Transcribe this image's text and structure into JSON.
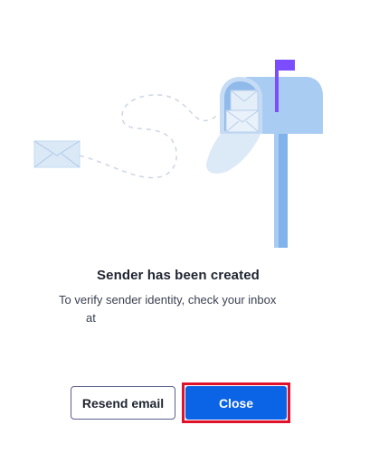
{
  "dialog": {
    "title": "Sender has been created",
    "message_line1": "To verify sender identity, check your inbox",
    "message_line2": "at",
    "resend_label": "Resend email",
    "close_label": "Close"
  },
  "illustration": {
    "icon": "mailbox-with-envelopes-icon",
    "colors": {
      "mailbox": "#a9ccf2",
      "post": "#7fb3ea",
      "envelope": "#dbe9f7",
      "flag": "#7b4dff",
      "trail": "#cfd8e3"
    }
  },
  "colors": {
    "primary": "#0b63e5",
    "highlight": "#e0112b",
    "text": "#1f2430"
  }
}
